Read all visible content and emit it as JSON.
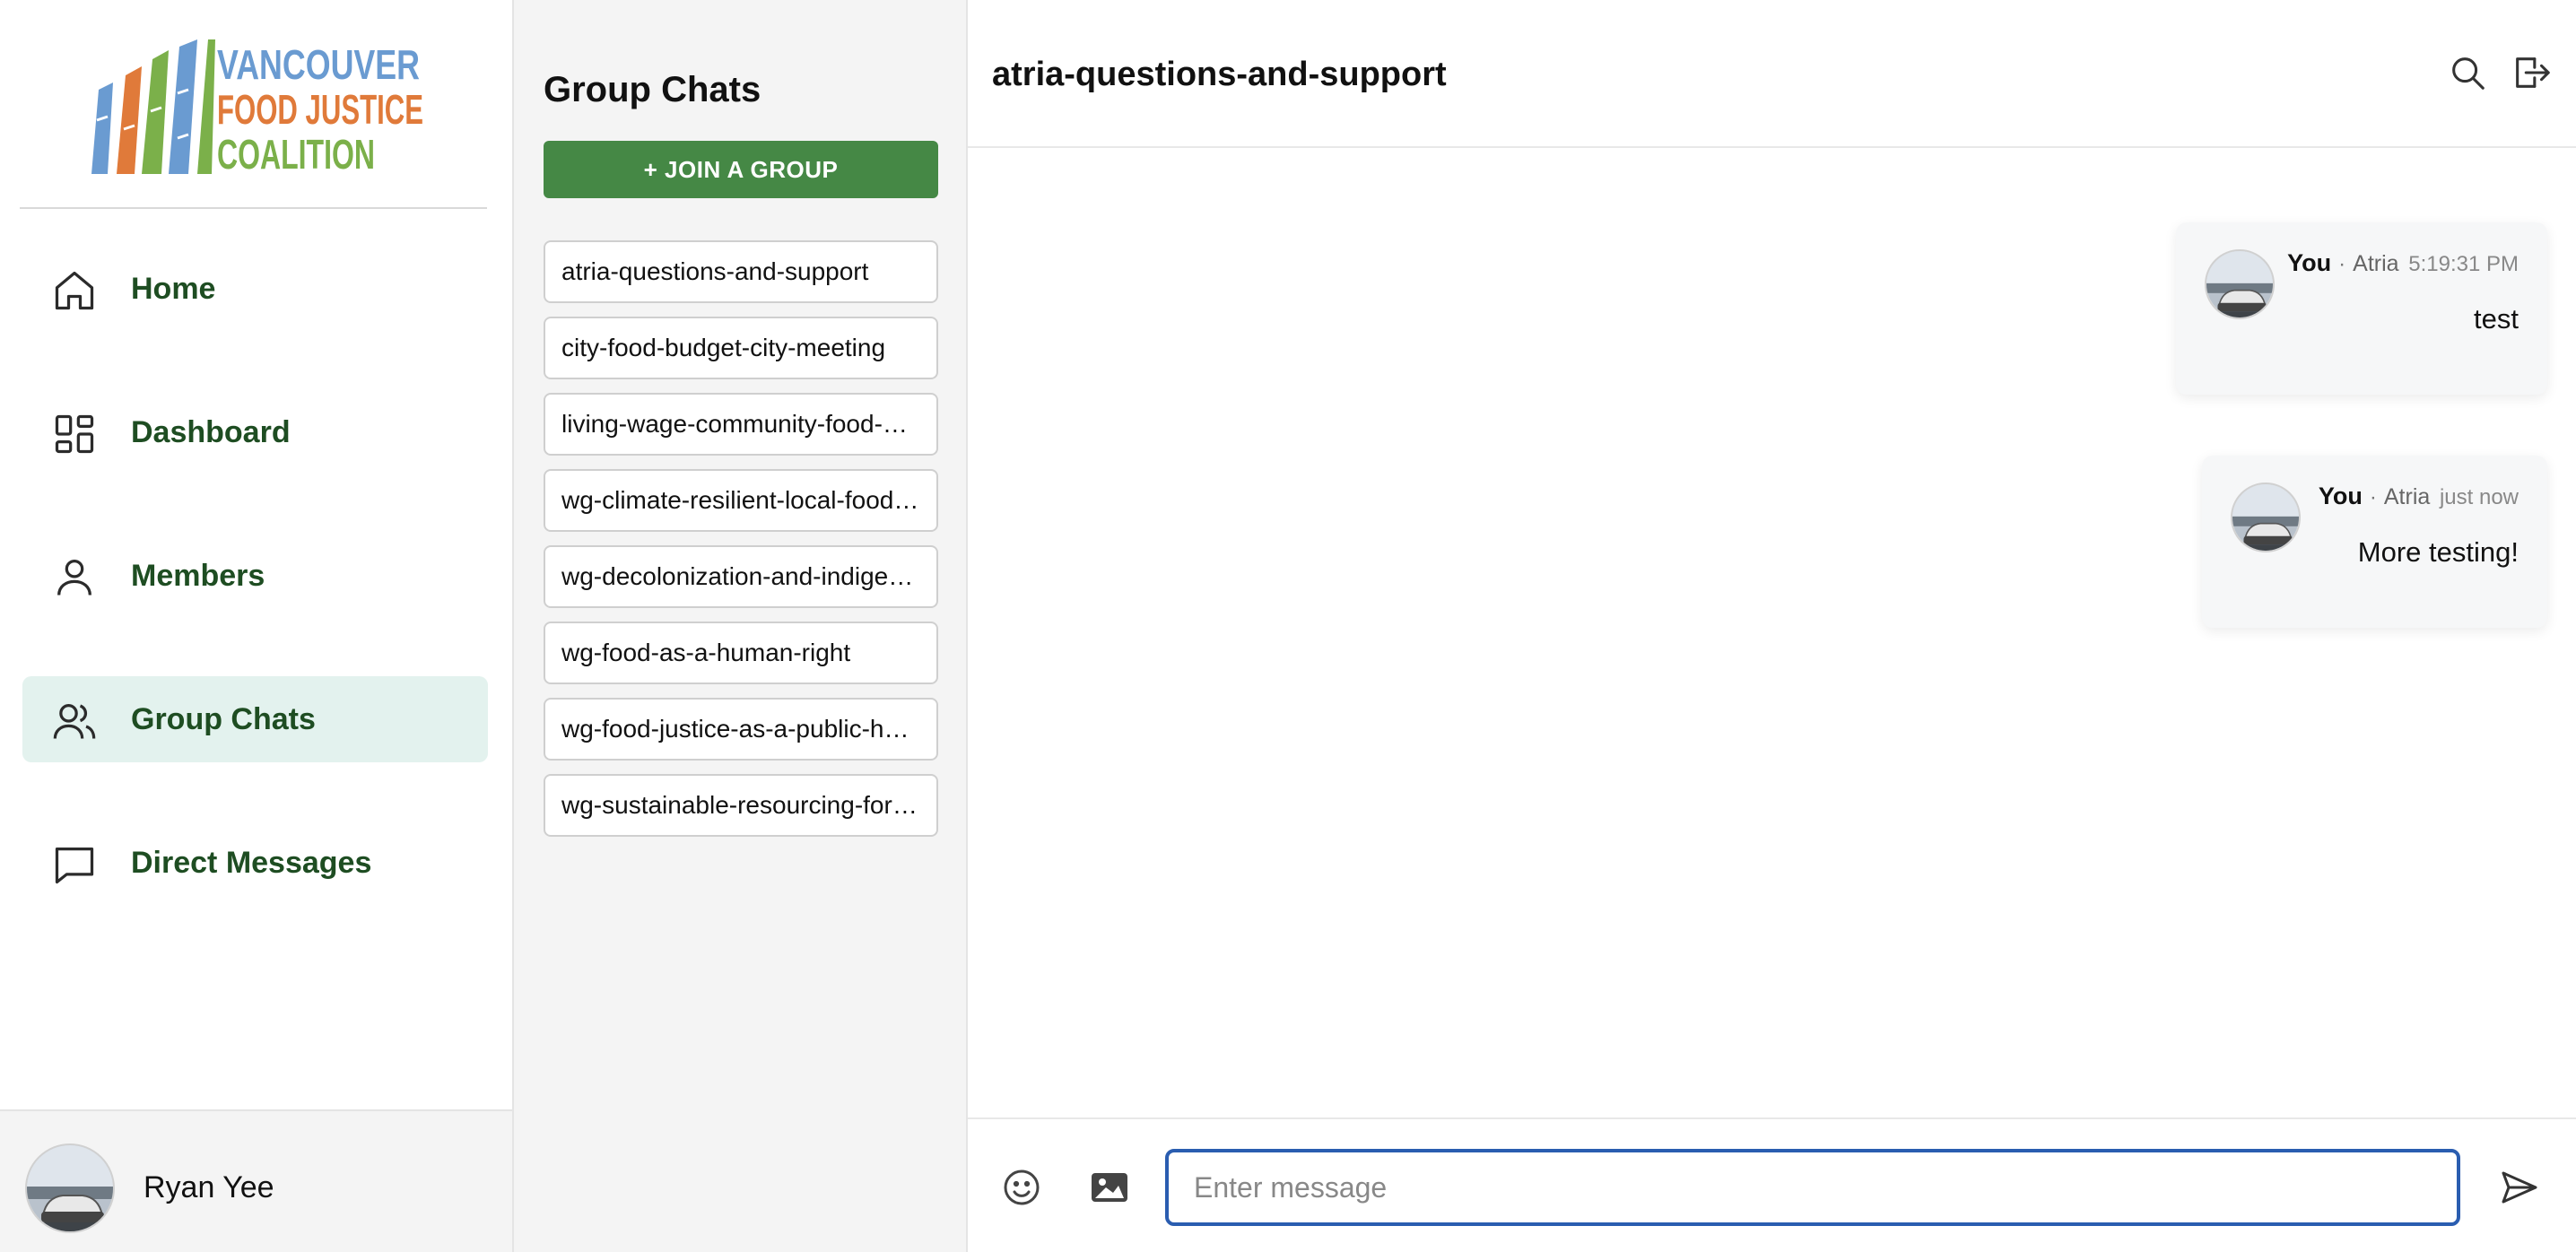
{
  "logo": {
    "line1": "VANCOUVER",
    "line2": "FOOD JUSTICE",
    "line3": "COALITION"
  },
  "nav": {
    "items": [
      {
        "label": "Home",
        "icon": "home-icon",
        "active": false
      },
      {
        "label": "Dashboard",
        "icon": "dashboard-icon",
        "active": false
      },
      {
        "label": "Members",
        "icon": "person-icon",
        "active": false
      },
      {
        "label": "Group Chats",
        "icon": "users-icon",
        "active": true
      },
      {
        "label": "Direct Messages",
        "icon": "chat-bubble-icon",
        "active": false
      }
    ],
    "user": {
      "name": "Ryan Yee"
    }
  },
  "groups": {
    "title": "Group Chats",
    "join_label": "+ JOIN A GROUP",
    "items": [
      "atria-questions-and-support",
      "city-food-budget-city-meeting",
      "living-wage-community-food-workers",
      "wg-climate-resilient-local-food-systems",
      "wg-decolonization-and-indigenous-food-sovereignty",
      "wg-food-as-a-human-right",
      "wg-food-justice-as-a-public-health-priority",
      "wg-sustainable-resourcing-for-food-programs"
    ]
  },
  "chat": {
    "title": "atria-questions-and-support",
    "messages": [
      {
        "sender": "You",
        "org": "Atria",
        "time": "5:19:31 PM",
        "text": "test"
      },
      {
        "sender": "You",
        "org": "Atria",
        "time": "just now",
        "text": "More testing!"
      }
    ],
    "composer": {
      "placeholder": "Enter message"
    }
  },
  "colors": {
    "brand_green": "#458845",
    "nav_text": "#1e4d22",
    "active_bg": "#e3f2ee",
    "input_border": "#2a5db0",
    "logo_blue": "#6a9bd1",
    "logo_orange": "#e07a3a",
    "logo_green": "#7bb04a"
  }
}
